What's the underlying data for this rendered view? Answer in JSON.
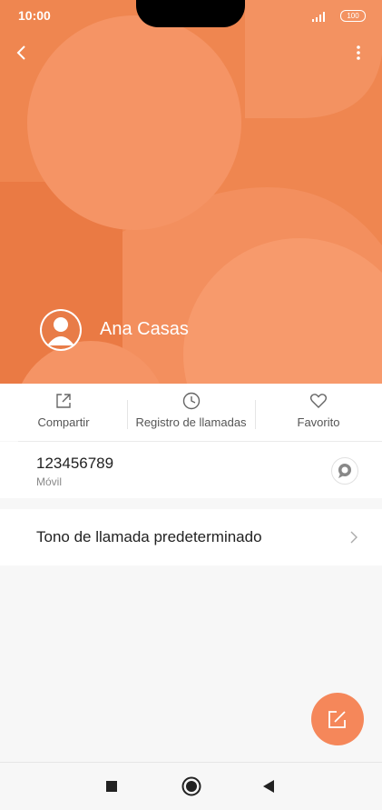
{
  "status": {
    "time": "10:00",
    "battery": "100"
  },
  "contact": {
    "name": "Ana Casas"
  },
  "actions": [
    {
      "label": "Compartir",
      "icon": "share-icon"
    },
    {
      "label": "Registro de llamadas",
      "icon": "clock-icon"
    },
    {
      "label": "Favorito",
      "icon": "heart-icon"
    }
  ],
  "phone": {
    "number": "123456789",
    "type": "Móvil"
  },
  "settings": {
    "ringtone_label": "Tono de llamada predeterminado"
  },
  "colors": {
    "accent": "#ef8650",
    "fab": "#f5875a"
  }
}
